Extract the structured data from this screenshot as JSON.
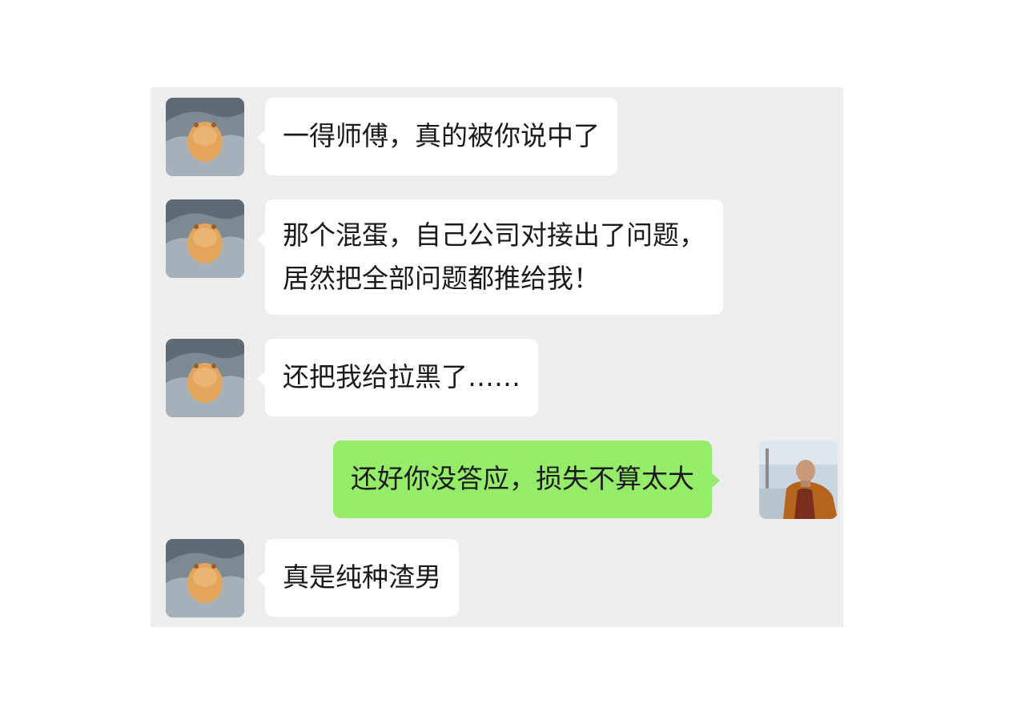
{
  "chat": {
    "messages": [
      {
        "sender": "contact",
        "avatar": "hamster-avatar",
        "lines": [
          "一得师傅，真的被你说中了"
        ]
      },
      {
        "sender": "contact",
        "avatar": "hamster-avatar",
        "lines": [
          "那个混蛋，自己公司对接出了问题，",
          "居然把全部问题都推给我！"
        ]
      },
      {
        "sender": "contact",
        "avatar": "hamster-avatar",
        "lines": [
          "还把我给拉黑了……"
        ]
      },
      {
        "sender": "me",
        "avatar": "monk-avatar",
        "lines": [
          "还好你没答应，损失不算太大"
        ]
      },
      {
        "sender": "contact",
        "avatar": "hamster-avatar",
        "lines": [
          "真是纯种渣男"
        ]
      }
    ]
  },
  "colors": {
    "panel_background": "#ededed",
    "incoming_bubble": "#ffffff",
    "outgoing_bubble": "#95ec69",
    "text": "#1a1a1a"
  }
}
